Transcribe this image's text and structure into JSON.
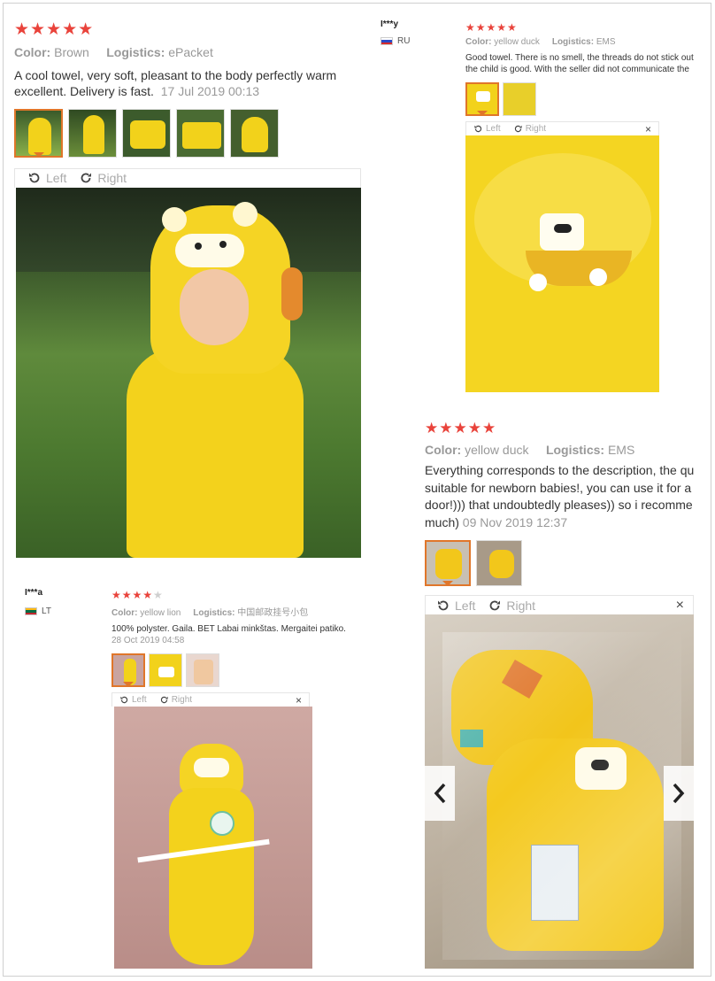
{
  "colors": {
    "star": "#e9433b",
    "accent": "#e0762a",
    "muted": "#999999",
    "towel": "#f2d21b"
  },
  "review1": {
    "stars": "★★★★★",
    "color_label": "Color:",
    "color_value": "Brown",
    "logistics_label": "Logistics:",
    "logistics_value": "ePacket",
    "text_line1": "A cool towel, very soft, pleasant to the body perfectly warm",
    "text_line2": "excellent. Delivery is fast.",
    "date": "17 Jul 2019 00:13",
    "rotate_left": "Left",
    "rotate_right": "Right",
    "photo_label": "child in yellow lion hooded towel on grass"
  },
  "review2": {
    "user": "I***y",
    "country": "RU",
    "stars": "★★★★★",
    "color_label": "Color:",
    "color_value": "yellow duck",
    "logistics_label": "Logistics:",
    "logistics_value": "EMS",
    "text_line1": "Good towel. There is no smell, the threads do not stick out",
    "text_line2": "the child is good. With the seller did not communicate the",
    "rotate_left": "Left",
    "rotate_right": "Right",
    "close": "×"
  },
  "review3": {
    "user": "I***a",
    "country": "LT",
    "stars_on": "★★★★",
    "stars_off": "★",
    "color_label": "Color:",
    "color_value": "yellow lion",
    "logistics_label": "Logistics:",
    "logistics_value": "中国邮政挂号小包",
    "text_line1": "100% polyster. Gaila. BET Labai minkštas. Mergaitei patiko.",
    "date": "28 Oct 2019 04:58",
    "rotate_left": "Left",
    "rotate_right": "Right",
    "close": "×"
  },
  "review4": {
    "stars": "★★★★★",
    "color_label": "Color:",
    "color_value": "yellow duck",
    "logistics_label": "Logistics:",
    "logistics_value": "EMS",
    "text_line1": "Everything corresponds to the description, the qu",
    "text_line2": "suitable for newborn babies!, you can use it for a",
    "text_line3": "door!))) that undoubtedly pleases)) so i recomme",
    "text_line4": "much)",
    "date": "09 Nov 2019 12:37",
    "rotate_left": "Left",
    "rotate_right": "Right",
    "close": "×"
  }
}
